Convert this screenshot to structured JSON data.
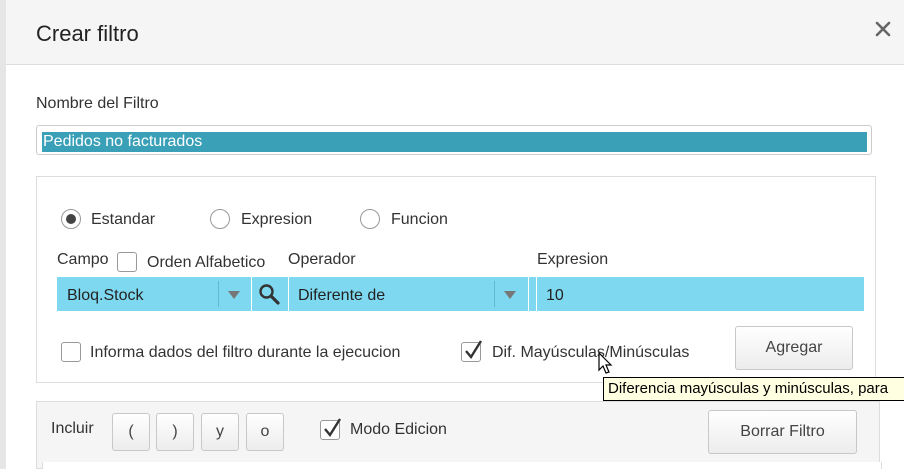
{
  "dialog": {
    "title": "Crear filtro"
  },
  "name_field": {
    "label": "Nombre del Filtro",
    "value": "Pedidos no facturados"
  },
  "type_options": [
    {
      "label": "Estandar",
      "selected": true
    },
    {
      "label": "Expresion",
      "selected": false
    },
    {
      "label": "Funcion",
      "selected": false
    }
  ],
  "campo": {
    "label": "Campo",
    "alpha_label": "Orden Alfabetico",
    "alpha_checked": false,
    "value": "Bloq.Stock"
  },
  "operador": {
    "label": "Operador",
    "value": "Diferente de"
  },
  "expresion": {
    "label": "Expresion",
    "value": "10"
  },
  "options": {
    "informa_label": "Informa dados del filtro durante la ejecucion",
    "informa_checked": false,
    "dif_label": "Dif. Mayúsculas/Minúsculas",
    "dif_checked": true
  },
  "buttons": {
    "agregar": "Agregar",
    "borrar": "Borrar Filtro"
  },
  "tooltip": {
    "text": "Diferencia mayúsculas y minúsculas, para"
  },
  "toolbar": {
    "incluir_label": "Incluir",
    "paren_open": "(",
    "paren_close": ")",
    "and": "y",
    "or": "o",
    "modo_label": "Modo Edicion",
    "modo_checked": true
  },
  "colors": {
    "selection": "#3aa0b8",
    "field_highlight": "#7ed9f0",
    "tooltip_bg": "#ffffe1"
  }
}
